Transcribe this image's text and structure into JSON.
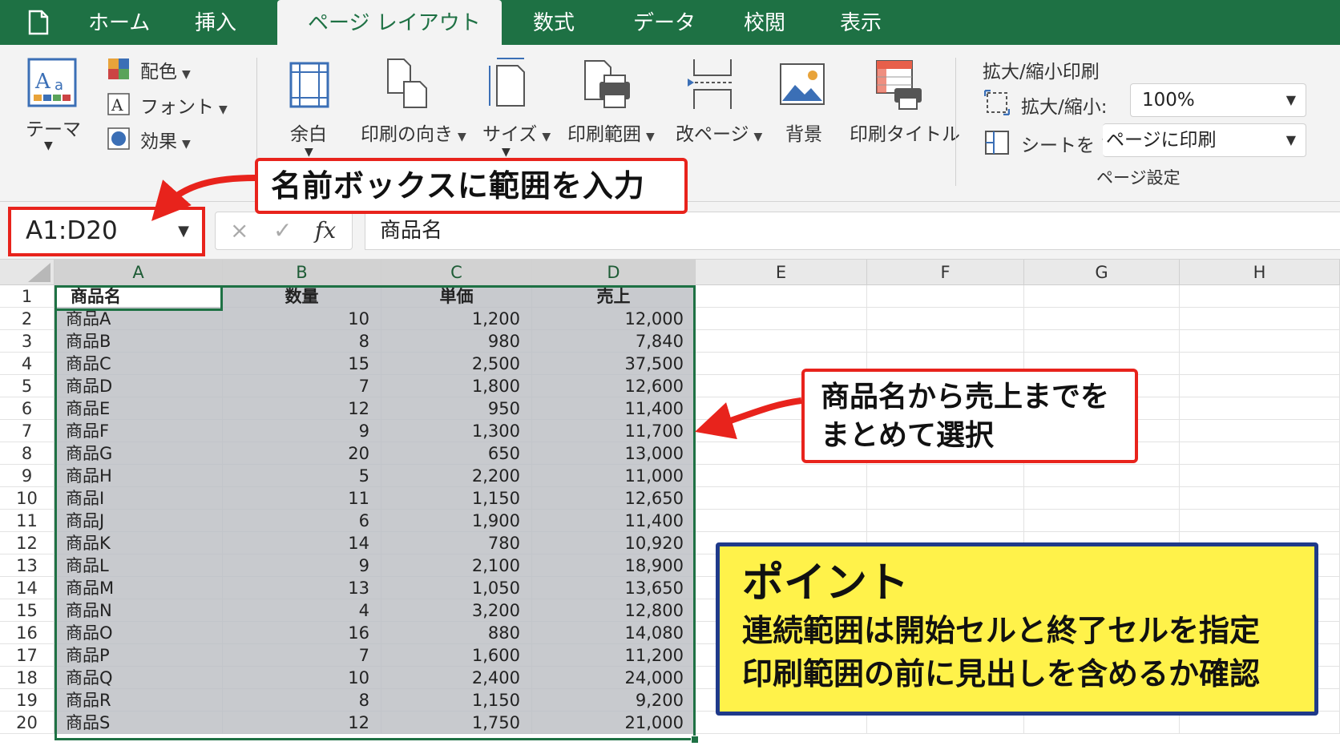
{
  "tabs": [
    {
      "label": "ホーム",
      "active": false
    },
    {
      "label": "挿入",
      "active": false
    },
    {
      "label": "ページ レイアウト",
      "active": true
    },
    {
      "label": "数式",
      "active": false
    },
    {
      "label": "データ",
      "active": false
    },
    {
      "label": "校閲",
      "active": false
    },
    {
      "label": "表示",
      "active": false
    }
  ],
  "ribbon": {
    "themes": {
      "theme_label": "テーマ",
      "colors_label": "配色",
      "fonts_label": "フォント",
      "effects_label": "効果"
    },
    "page_setup": {
      "margins_label": "余白",
      "orientation_label": "印刷の向き",
      "size_label": "サイズ",
      "print_area_label": "印刷範囲",
      "breaks_label": "改ページ",
      "background_label": "背景",
      "print_titles_label": "印刷タイトル"
    },
    "scale": {
      "group_label": "拡大/縮小印刷",
      "scale_label": "拡大/縮小:",
      "scale_value": "100%",
      "fit_label": "シートを 1",
      "fit_value": "ページに印刷",
      "footer_label": "ページ設定"
    }
  },
  "formula_bar": {
    "name_box": "A1:D20",
    "cancel_glyph": "×",
    "enter_glyph": "✓",
    "fx_label": "fx",
    "content": "商品名"
  },
  "grid": {
    "columns": [
      "A",
      "B",
      "C",
      "D",
      "E",
      "F",
      "G",
      "H"
    ],
    "rows": [
      "1",
      "2",
      "3",
      "4",
      "5",
      "6",
      "7",
      "8",
      "9",
      "10",
      "11",
      "12",
      "13",
      "14",
      "15",
      "16",
      "17",
      "18",
      "19",
      "20"
    ],
    "header_row": [
      "商品名",
      "数量",
      "単価",
      "売上"
    ],
    "data_rows": [
      [
        "商品A",
        "10",
        "1,200",
        "12,000"
      ],
      [
        "商品B",
        "8",
        "980",
        "7,840"
      ],
      [
        "商品C",
        "15",
        "2,500",
        "37,500"
      ],
      [
        "商品D",
        "7",
        "1,800",
        "12,600"
      ],
      [
        "商品E",
        "12",
        "950",
        "11,400"
      ],
      [
        "商品F",
        "9",
        "1,300",
        "11,700"
      ],
      [
        "商品G",
        "20",
        "650",
        "13,000"
      ],
      [
        "商品H",
        "5",
        "2,200",
        "11,000"
      ],
      [
        "商品I",
        "11",
        "1,150",
        "12,650"
      ],
      [
        "商品J",
        "6",
        "1,900",
        "11,400"
      ],
      [
        "商品K",
        "14",
        "780",
        "10,920"
      ],
      [
        "商品L",
        "9",
        "2,100",
        "18,900"
      ],
      [
        "商品M",
        "13",
        "1,050",
        "13,650"
      ],
      [
        "商品N",
        "4",
        "3,200",
        "12,800"
      ],
      [
        "商品O",
        "16",
        "880",
        "14,080"
      ],
      [
        "商品P",
        "7",
        "1,600",
        "11,200"
      ],
      [
        "商品Q",
        "10",
        "2,400",
        "24,000"
      ],
      [
        "商品R",
        "8",
        "1,150",
        "9,200"
      ],
      [
        "商品S",
        "12",
        "1,750",
        "21,000"
      ]
    ]
  },
  "callouts": {
    "name_box": "名前ボックスに範囲を入力",
    "selection_line1": "商品名から売上までを",
    "selection_line2": "まとめて選択",
    "point_title": "ポイント",
    "point_line1": "連続範囲は開始セルと終了セルを指定",
    "point_line2": "印刷範囲の前に見出しを含めるか確認"
  },
  "colors": {
    "excel_green": "#1e7144",
    "callout_red": "#e8231c",
    "point_yellow": "#fff24a",
    "point_border": "#1f3a8a",
    "selection_fill": "#c8cace"
  }
}
